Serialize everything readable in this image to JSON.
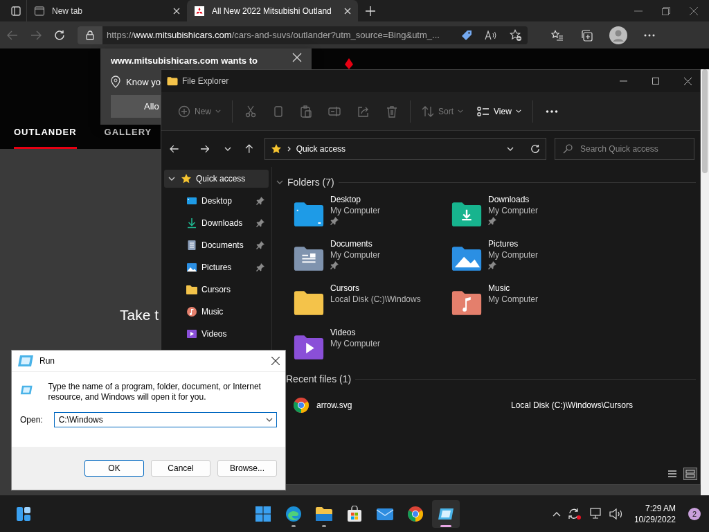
{
  "browser": {
    "tabs": [
      {
        "title": "New tab",
        "selected": false
      },
      {
        "title": "All New 2022 Mitsubishi Outland",
        "selected": true
      }
    ],
    "back": {
      "disabled": true
    },
    "forward": {
      "disabled": true
    },
    "url": "https://**www.mitsubishicars.com**/cars-and-suvs/outlander?utm_source=Bing&utm_...",
    "page": {
      "nav": [
        {
          "label": "OUTLANDER",
          "selected": true
        },
        {
          "label": "GALLERY",
          "selected": false
        }
      ],
      "hero_text": "Take t"
    },
    "permission_popup": {
      "title": "www.mitsubishicars.com wants to",
      "request": "Know yo",
      "button": "Allo"
    }
  },
  "file_explorer": {
    "title": "File Explorer",
    "toolbar": [
      {
        "kind": "new",
        "label": "New",
        "disabled": true
      },
      {
        "kind": "cut",
        "disabled": true
      },
      {
        "kind": "copy",
        "disabled": true
      },
      {
        "kind": "paste",
        "disabled": true
      },
      {
        "kind": "rename",
        "disabled": true
      },
      {
        "kind": "share",
        "disabled": true
      },
      {
        "kind": "delete",
        "disabled": true
      },
      {
        "kind": "sort",
        "label": "Sort",
        "disabled": true
      },
      {
        "kind": "view",
        "label": "View",
        "disabled": false
      },
      {
        "kind": "more"
      }
    ],
    "address": "Quick access",
    "search": {
      "placeholder": "Search Quick access"
    },
    "sidebar": [
      {
        "label": "Quick access",
        "kind": "star",
        "expanded": true,
        "selected": true,
        "children": [
          {
            "label": "Desktop",
            "kind": "desktop",
            "pinned": true,
            "selected": false
          },
          {
            "label": "Downloads",
            "kind": "downloads",
            "pinned": true,
            "selected": false
          },
          {
            "label": "Documents",
            "kind": "documents",
            "pinned": true,
            "selected": false
          },
          {
            "label": "Pictures",
            "kind": "pictures",
            "pinned": true,
            "selected": false
          },
          {
            "label": "Cursors",
            "kind": "folder",
            "pinned": false,
            "selected": false
          },
          {
            "label": "Music",
            "kind": "music",
            "pinned": false,
            "selected": false
          },
          {
            "label": "Videos",
            "kind": "videos",
            "pinned": false,
            "selected": false
          }
        ]
      }
    ],
    "folders": {
      "heading": "Folders (7)",
      "expanded": true,
      "items": [
        {
          "name": "Desktop",
          "location": "My Computer",
          "kind": "desktop",
          "pinned": true
        },
        {
          "name": "Downloads",
          "location": "My Computer",
          "kind": "downloads",
          "pinned": true
        },
        {
          "name": "Documents",
          "location": "My Computer",
          "kind": "documents",
          "pinned": true
        },
        {
          "name": "Pictures",
          "location": "My Computer",
          "kind": "pictures",
          "pinned": true
        },
        {
          "name": "Cursors",
          "location": "Local Disk (C:)\\Windows",
          "kind": "folder",
          "pinned": false
        },
        {
          "name": "Music",
          "location": "My Computer",
          "kind": "music",
          "pinned": false
        },
        {
          "name": "Videos",
          "location": "My Computer",
          "kind": "videos",
          "pinned": false
        }
      ]
    },
    "recent": {
      "heading": "Recent files (1)",
      "files": [
        {
          "name": "arrow.svg",
          "location": "Local Disk (C:)\\Windows\\Cursors"
        }
      ]
    },
    "view_buttons": [
      {
        "kind": "details",
        "selected": false
      },
      {
        "kind": "tiles",
        "selected": true
      }
    ]
  },
  "run_dialog": {
    "title": "Run",
    "description": "Type the name of a program, folder, document, or Internet resource, and Windows will open it for you.",
    "open_label": "Open:",
    "value": "C:\\Windows",
    "buttons": [
      {
        "label": "OK",
        "default": true
      },
      {
        "label": "Cancel",
        "default": false
      },
      {
        "label": "Browse...",
        "default": false
      }
    ]
  },
  "taskbar": {
    "apps": [
      {
        "kind": "start",
        "running": false,
        "active": false
      },
      {
        "kind": "edge",
        "running": true,
        "active": false
      },
      {
        "kind": "explorer",
        "running": true,
        "active": false
      },
      {
        "kind": "store",
        "running": false,
        "active": false
      },
      {
        "kind": "mail",
        "running": false,
        "active": false
      },
      {
        "kind": "chrome",
        "running": false,
        "active": false
      },
      {
        "kind": "run",
        "running": true,
        "active": true
      }
    ],
    "time": "7:29 AM",
    "date": "10/29/2022",
    "notifications": "2"
  }
}
